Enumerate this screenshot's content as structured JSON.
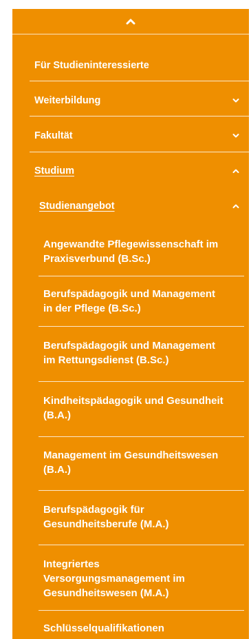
{
  "nav": {
    "collapse_icon": "chevron-up-icon",
    "top_items": [
      {
        "label": "Für Studieninteressierte",
        "icon": null
      },
      {
        "label": "Weiterbildung",
        "icon": "chevron-down-icon"
      },
      {
        "label": "Fakultät",
        "icon": "chevron-down-icon"
      },
      {
        "label": "Studium",
        "icon": "chevron-up-icon",
        "active": true
      }
    ],
    "submenu": {
      "label": "Studienangebot",
      "icon": "chevron-up-icon",
      "items": [
        "Angewandte Pflegewissenschaft im\nPraxisverbund (B.Sc.)",
        "Berufspädagogik und Management\nin der Pflege (B.Sc.)",
        "Berufspädagogik und Management\nim Rettungsdienst (B.Sc.)",
        "Kindheitspädagogik und Gesundheit\n(B.A.)",
        "Management im Gesundheitswesen\n(B.A.)",
        "Berufspädagogik für\nGesundheitsberufe (M.A.)",
        "Integriertes\nVersorgungsmanagement im\nGesundheitswesen (M.A.)",
        "Schlüsselqualifikationen"
      ]
    }
  },
  "colors": {
    "background": "#ef8f00",
    "text": "#ffffff"
  }
}
